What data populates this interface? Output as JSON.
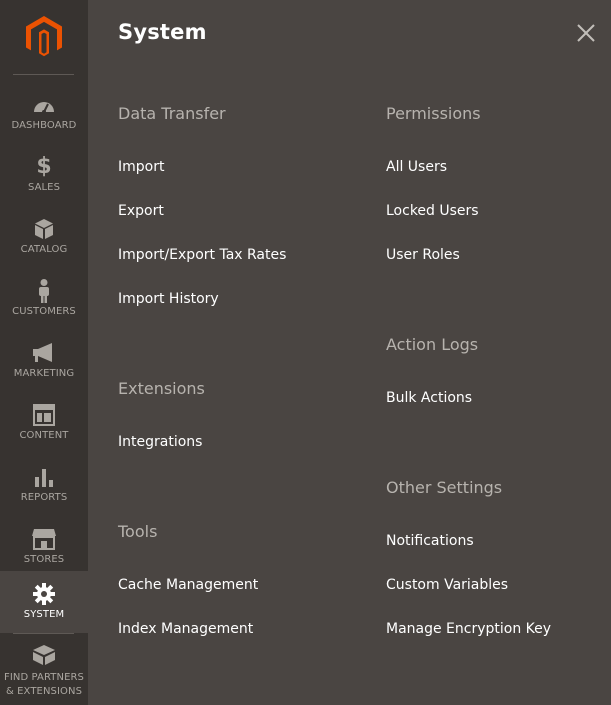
{
  "sidebar": {
    "items": [
      {
        "label": "DASHBOARD",
        "icon": "dashboard-icon"
      },
      {
        "label": "SALES",
        "icon": "dollar-icon"
      },
      {
        "label": "CATALOG",
        "icon": "box-icon"
      },
      {
        "label": "CUSTOMERS",
        "icon": "person-icon"
      },
      {
        "label": "MARKETING",
        "icon": "megaphone-icon"
      },
      {
        "label": "CONTENT",
        "icon": "layout-icon"
      },
      {
        "label": "REPORTS",
        "icon": "bar-chart-icon"
      },
      {
        "label": "STORES",
        "icon": "storefront-icon"
      },
      {
        "label": "SYSTEM",
        "icon": "gear-icon",
        "active": true
      },
      {
        "label_line1": "FIND PARTNERS",
        "label_line2": "& EXTENSIONS",
        "icon": "blocks-icon"
      }
    ]
  },
  "panel": {
    "title": "System",
    "close_icon": "close-icon",
    "left_column": {
      "data_transfer": {
        "title": "Data Transfer",
        "links": [
          "Import",
          "Export",
          "Import/Export Tax Rates",
          "Import History"
        ]
      },
      "extensions": {
        "title": "Extensions",
        "links": [
          "Integrations"
        ]
      },
      "tools": {
        "title": "Tools",
        "links": [
          "Cache Management",
          "Index Management"
        ]
      }
    },
    "right_column": {
      "permissions": {
        "title": "Permissions",
        "links": [
          "All Users",
          "Locked Users",
          "User Roles"
        ]
      },
      "action_logs": {
        "title": "Action Logs",
        "links": [
          "Bulk Actions"
        ]
      },
      "other_settings": {
        "title": "Other Settings",
        "links": [
          "Notifications",
          "Custom Variables",
          "Manage Encryption Key"
        ]
      }
    }
  },
  "colors": {
    "sidebar_bg": "#373330",
    "panel_bg": "#4a4542",
    "logo_orange": "#eb5202",
    "section_title": "#b7b3ae",
    "nav_label": "#aaa6a0"
  }
}
